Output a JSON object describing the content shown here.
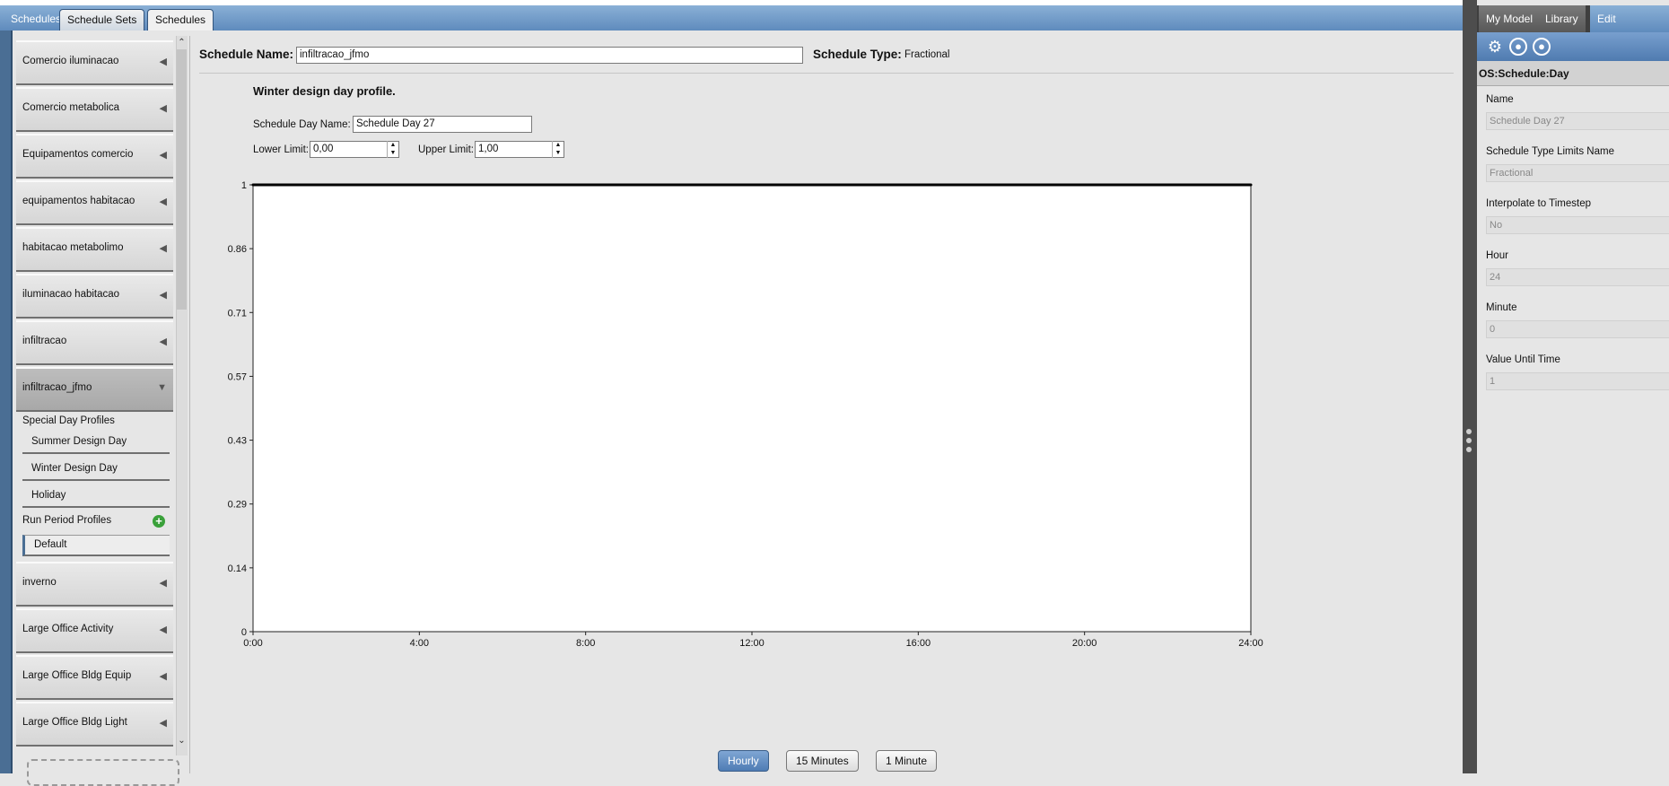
{
  "tabs": {
    "plain": "Schedules",
    "schedule_sets": "Schedule Sets",
    "schedules": "Schedules"
  },
  "sidebar": {
    "items": [
      {
        "label": "Comercio iluminacao"
      },
      {
        "label": "Comercio metabolica"
      },
      {
        "label": "Equipamentos comercio"
      },
      {
        "label": "equipamentos habitacao"
      },
      {
        "label": "habitacao metabolimo"
      },
      {
        "label": "iluminacao habitacao"
      },
      {
        "label": "infiltracao"
      },
      {
        "label": "infiltracao_jfmo"
      }
    ],
    "special_header": "Special Day Profiles",
    "special_items": [
      "Summer Design Day",
      "Winter Design Day",
      "Holiday"
    ],
    "run_header": "Run Period Profiles",
    "run_items": [
      "Default"
    ],
    "items_after": [
      {
        "label": "inverno"
      },
      {
        "label": "Large Office Activity"
      },
      {
        "label": "Large Office Bldg Equip"
      },
      {
        "label": "Large Office Bldg Light"
      }
    ]
  },
  "schedule": {
    "name_label": "Schedule Name:",
    "name_value": "infiltracao_jfmo",
    "type_label": "Schedule Type:",
    "type_value": "Fractional",
    "profile_title": "Winter design day profile.",
    "day_name_label": "Schedule Day Name:",
    "day_name_value": "Schedule Day 27",
    "lower_label": "Lower Limit:",
    "lower_value": "0,00",
    "upper_label": "Upper Limit:",
    "upper_value": "1,00"
  },
  "chart_data": {
    "type": "line",
    "x_ticks": [
      "0:00",
      "4:00",
      "8:00",
      "12:00",
      "16:00",
      "20:00",
      "24:00"
    ],
    "y_ticks": [
      "0",
      "0.14",
      "0.29",
      "0.43",
      "0.57",
      "0.71",
      "0.86",
      "1"
    ],
    "xlim": [
      0,
      24
    ],
    "ylim": [
      0,
      1
    ],
    "x": [
      0,
      24
    ],
    "y": [
      1,
      1
    ],
    "grid": false
  },
  "buttons": {
    "hourly": "Hourly",
    "fifteen": "15 Minutes",
    "one": "1 Minute"
  },
  "right": {
    "tabs": [
      "My Model",
      "Library",
      "Edit"
    ],
    "header": "OS:Schedule:Day",
    "fields": [
      {
        "label": "Name",
        "value": "Schedule Day 27"
      },
      {
        "label": "Schedule Type Limits Name",
        "value": "Fractional"
      },
      {
        "label": "Interpolate to Timestep",
        "value": "No"
      },
      {
        "label": "Hour",
        "value": "24"
      },
      {
        "label": "Minute",
        "value": "0"
      },
      {
        "label": "Value Until Time",
        "value": "1"
      }
    ]
  },
  "colors": {
    "accent": "#5f8bbd",
    "selected_button": "#4f7cb4",
    "add": "#3aa13a"
  }
}
